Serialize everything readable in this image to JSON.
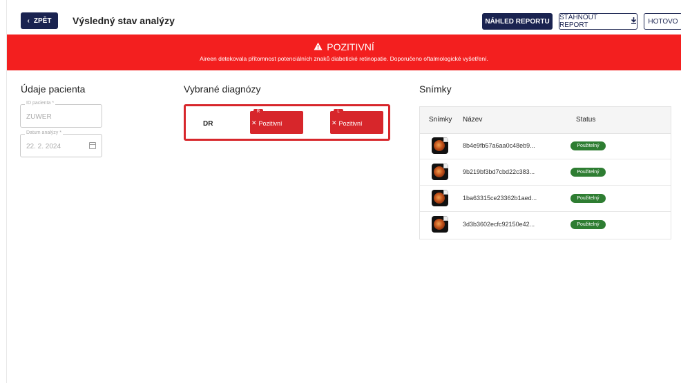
{
  "header": {
    "back_label": "ZPĚT",
    "title": "Výsledný stav analýzy",
    "preview_label": "NÁHLED REPORTU",
    "download_label": "STÁHNOUT REPORT",
    "done_label": "HOTOVO"
  },
  "banner": {
    "title": "POZITIVNÍ",
    "text": "Aireen detekovala přítomnost potenciálních znaků diabetické retinopatie. Doporučeno oftalmologické vyšetření.",
    "color": "#f31f1f"
  },
  "patient": {
    "title": "Údaje pacienta",
    "id_label": "ID pacienta *",
    "id_value": "ZUWER",
    "date_label": "Datum analýzy *",
    "date_value": "22. 2. 2024"
  },
  "diagnoses": {
    "title": "Vybrané diagnózy",
    "row_label": "DR",
    "right_tab": "R",
    "left_tab": "L",
    "right_value": "Pozitivní",
    "left_value": "Pozitivní",
    "color": "#d7262b"
  },
  "images": {
    "title": "Snímky",
    "columns": [
      "Snímky",
      "Název",
      "Status"
    ],
    "rows": [
      {
        "name": "8b4e9fb57a6aa0c48eb9...",
        "status": "Použitelný"
      },
      {
        "name": "9b219bf3bd7cbd22c383...",
        "status": "Použitelný"
      },
      {
        "name": "1ba63315ce23362b1aed...",
        "status": "Použitelný"
      },
      {
        "name": "3d3b3602ecfc92150e42...",
        "status": "Použitelný"
      }
    ],
    "status_color": "#2e7d32"
  }
}
